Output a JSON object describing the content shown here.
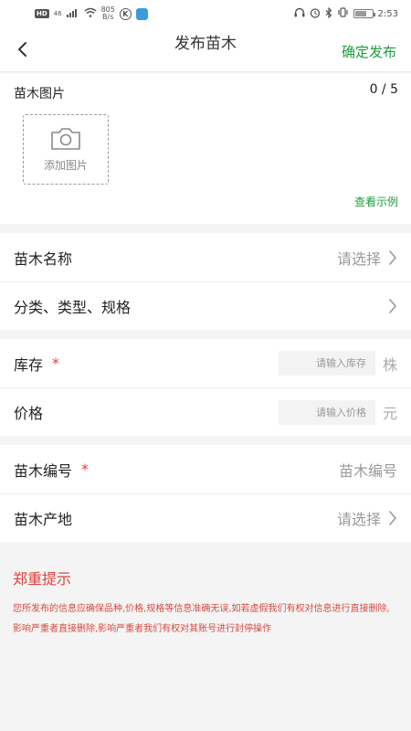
{
  "status_bar": {
    "hd": "HD",
    "network": "46",
    "speed_value": "805",
    "speed_unit": "B/s",
    "app_letter": "K",
    "time": "2:53"
  },
  "nav": {
    "title": "发布苗木",
    "publish_label": "确定发布"
  },
  "photos": {
    "label": "苗木图片",
    "count": "0 / 5",
    "add_label": "添加图片",
    "example_link": "查看示例"
  },
  "form": {
    "name": {
      "label": "苗木名称",
      "value": "请选择"
    },
    "category": {
      "label": "分类、类型、规格"
    },
    "stock": {
      "label": "库存",
      "required": "*",
      "placeholder": "请输入库存",
      "unit": "株"
    },
    "price": {
      "label": "价格",
      "placeholder": "请输入价格",
      "unit": "元"
    },
    "code": {
      "label": "苗木编号",
      "required": "*",
      "placeholder": "苗木编号"
    },
    "origin": {
      "label": "苗木产地",
      "value": "请选择"
    }
  },
  "notice": {
    "title": "郑重提示",
    "body": "您所发布的信息应确保品种,价格,规格等信息准确无误,如若虚假我们有权对信息进行直接删除,影响严重者直接删除,影响严重者我们有权对其账号进行封停操作"
  },
  "colors": {
    "accent_green": "#1a9e3a",
    "alert_red": "#e0403a"
  }
}
